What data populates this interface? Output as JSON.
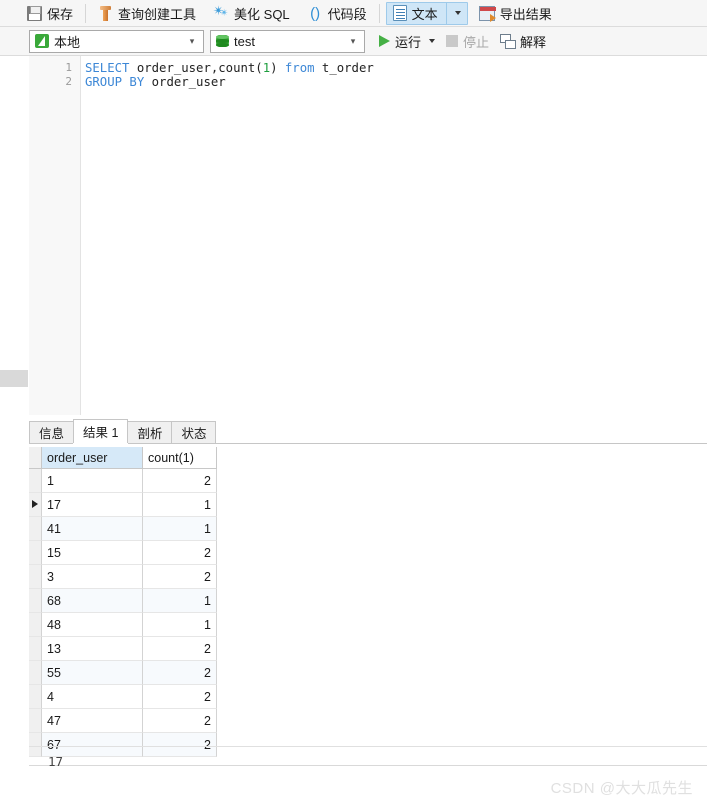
{
  "toolbar": {
    "save_label": "保存",
    "query_builder_label": "查询创建工具",
    "beautify_label": "美化 SQL",
    "snippet_label": "代码段",
    "text_label": "文本",
    "export_label": "导出结果"
  },
  "toolbar2": {
    "connection_value": "本地",
    "database_value": "test",
    "run_label": "运行",
    "stop_label": "停止",
    "explain_label": "解释"
  },
  "editor": {
    "lines": [
      {
        "number": "1",
        "tokens": [
          {
            "t": "SELECT",
            "c": "kw"
          },
          {
            "t": " order_user,count(",
            "c": "pnc"
          },
          {
            "t": "1",
            "c": "num"
          },
          {
            "t": ") ",
            "c": "pnc"
          },
          {
            "t": "from",
            "c": "kw"
          },
          {
            "t": " t_order",
            "c": "pnc"
          }
        ]
      },
      {
        "number": "2",
        "tokens": [
          {
            "t": "GROUP BY",
            "c": "kw"
          },
          {
            "t": " order_user",
            "c": "pnc"
          }
        ]
      }
    ],
    "plain_text": "SELECT order_user,count(1) from t_order\nGROUP BY order_user"
  },
  "result": {
    "tabs": [
      {
        "label": "信息",
        "active": false
      },
      {
        "label": "结果 1",
        "active": true
      },
      {
        "label": "剖析",
        "active": false
      },
      {
        "label": "状态",
        "active": false
      }
    ],
    "columns": [
      "order_user",
      "count(1)"
    ],
    "selected_column": "order_user",
    "current_row_index": 1,
    "rows": [
      {
        "order_user": "1",
        "count": "2"
      },
      {
        "order_user": "17",
        "count": "1"
      },
      {
        "order_user": "41",
        "count": "1"
      },
      {
        "order_user": "15",
        "count": "2"
      },
      {
        "order_user": "3",
        "count": "2"
      },
      {
        "order_user": "68",
        "count": "1"
      },
      {
        "order_user": "48",
        "count": "1"
      },
      {
        "order_user": "13",
        "count": "2"
      },
      {
        "order_user": "55",
        "count": "2"
      },
      {
        "order_user": "4",
        "count": "2"
      },
      {
        "order_user": "47",
        "count": "2"
      },
      {
        "order_user": "67",
        "count": "2"
      }
    ],
    "status_value": "17"
  },
  "watermark": "CSDN @大大瓜先生",
  "colors": {
    "keyword": "#3c87d6",
    "number": "#1f9e3f",
    "accent_green": "#45b045",
    "selection_blue": "#d6e9f8",
    "toolbar_bg": "#f6f6f6"
  }
}
